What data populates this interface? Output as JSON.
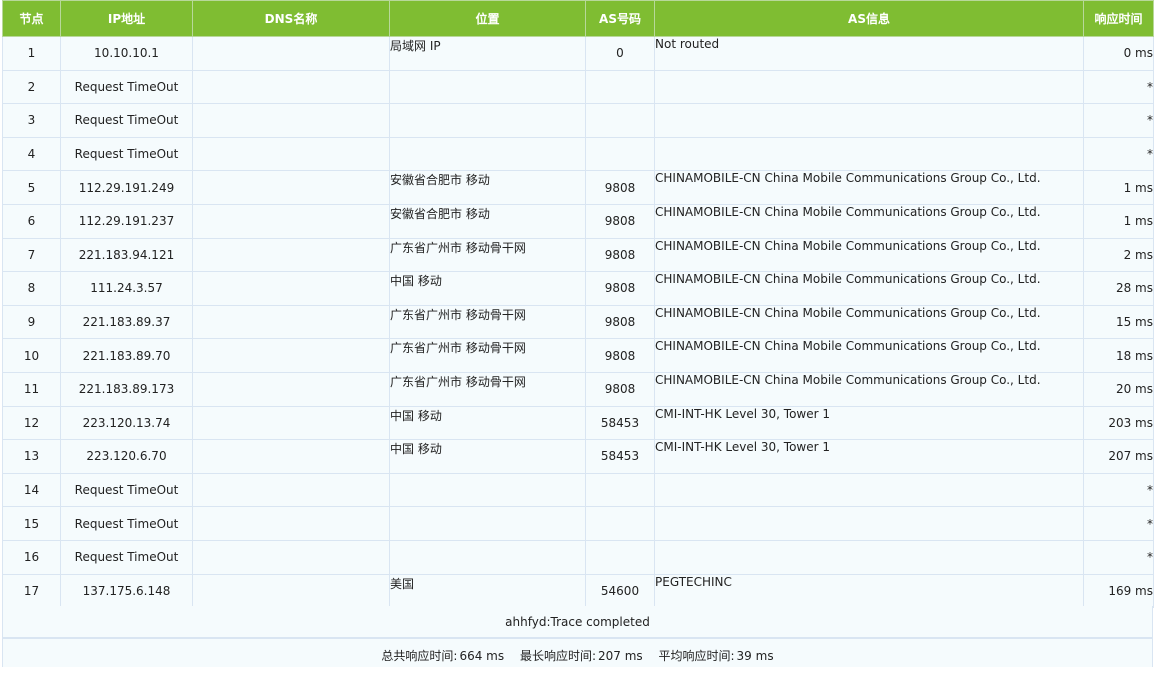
{
  "headers": [
    "节点",
    "IP地址",
    "DNS名称",
    "位置",
    "AS号码",
    "AS信息",
    "响应时间"
  ],
  "rows": [
    {
      "node": "1",
      "ip": "10.10.10.1",
      "dns": "",
      "location": "局域网 IP",
      "asn": "0",
      "as_info": "Not routed",
      "time": "0 ms"
    },
    {
      "node": "2",
      "ip": "Request TimeOut",
      "dns": "",
      "location": "",
      "asn": "",
      "as_info": "",
      "time": "*"
    },
    {
      "node": "3",
      "ip": "Request TimeOut",
      "dns": "",
      "location": "",
      "asn": "",
      "as_info": "",
      "time": "*"
    },
    {
      "node": "4",
      "ip": "Request TimeOut",
      "dns": "",
      "location": "",
      "asn": "",
      "as_info": "",
      "time": "*"
    },
    {
      "node": "5",
      "ip": "112.29.191.249",
      "dns": "",
      "location": "安徽省合肥市 移动",
      "asn": "9808",
      "as_info": "CHINAMOBILE-CN China Mobile Communications Group Co., Ltd.",
      "time": "1 ms"
    },
    {
      "node": "6",
      "ip": "112.29.191.237",
      "dns": "",
      "location": "安徽省合肥市 移动",
      "asn": "9808",
      "as_info": "CHINAMOBILE-CN China Mobile Communications Group Co., Ltd.",
      "time": "1 ms"
    },
    {
      "node": "7",
      "ip": "221.183.94.121",
      "dns": "",
      "location": "广东省广州市 移动骨干网",
      "asn": "9808",
      "as_info": "CHINAMOBILE-CN China Mobile Communications Group Co., Ltd.",
      "time": "2 ms"
    },
    {
      "node": "8",
      "ip": "111.24.3.57",
      "dns": "",
      "location": "中国 移动",
      "asn": "9808",
      "as_info": "CHINAMOBILE-CN China Mobile Communications Group Co., Ltd.",
      "time": "28 ms"
    },
    {
      "node": "9",
      "ip": "221.183.89.37",
      "dns": "",
      "location": "广东省广州市 移动骨干网",
      "asn": "9808",
      "as_info": "CHINAMOBILE-CN China Mobile Communications Group Co., Ltd.",
      "time": "15 ms"
    },
    {
      "node": "10",
      "ip": "221.183.89.70",
      "dns": "",
      "location": "广东省广州市 移动骨干网",
      "asn": "9808",
      "as_info": "CHINAMOBILE-CN China Mobile Communications Group Co., Ltd.",
      "time": "18 ms"
    },
    {
      "node": "11",
      "ip": "221.183.89.173",
      "dns": "",
      "location": "广东省广州市 移动骨干网",
      "asn": "9808",
      "as_info": "CHINAMOBILE-CN China Mobile Communications Group Co., Ltd.",
      "time": "20 ms"
    },
    {
      "node": "12",
      "ip": "223.120.13.74",
      "dns": "",
      "location": "中国 移动",
      "asn": "58453",
      "as_info": "CMI-INT-HK Level 30, Tower 1",
      "time": "203 ms"
    },
    {
      "node": "13",
      "ip": "223.120.6.70",
      "dns": "",
      "location": "中国 移动",
      "asn": "58453",
      "as_info": "CMI-INT-HK Level 30, Tower 1",
      "time": "207 ms"
    },
    {
      "node": "14",
      "ip": "Request TimeOut",
      "dns": "",
      "location": "",
      "asn": "",
      "as_info": "",
      "time": "*"
    },
    {
      "node": "15",
      "ip": "Request TimeOut",
      "dns": "",
      "location": "",
      "asn": "",
      "as_info": "",
      "time": "*"
    },
    {
      "node": "16",
      "ip": "Request TimeOut",
      "dns": "",
      "location": "",
      "asn": "",
      "as_info": "",
      "time": "*"
    },
    {
      "node": "17",
      "ip": "137.175.6.148",
      "dns": "",
      "location": "美国",
      "asn": "54600",
      "as_info": "PEGTECHINC",
      "time": "169 ms"
    }
  ],
  "footer": {
    "completed": "ahhfyd:Trace completed",
    "total_label": "总共响应时间:",
    "total_value": "664 ms",
    "max_label": "最长响应时间:",
    "max_value": "207 ms",
    "avg_label": "平均响应时间:",
    "avg_value": "39 ms"
  },
  "colors": {
    "header_bg": "#7fbd32",
    "header_text": "#ffffff",
    "row_bg": "#f5fbfd",
    "grid": "#d9e5f2"
  }
}
